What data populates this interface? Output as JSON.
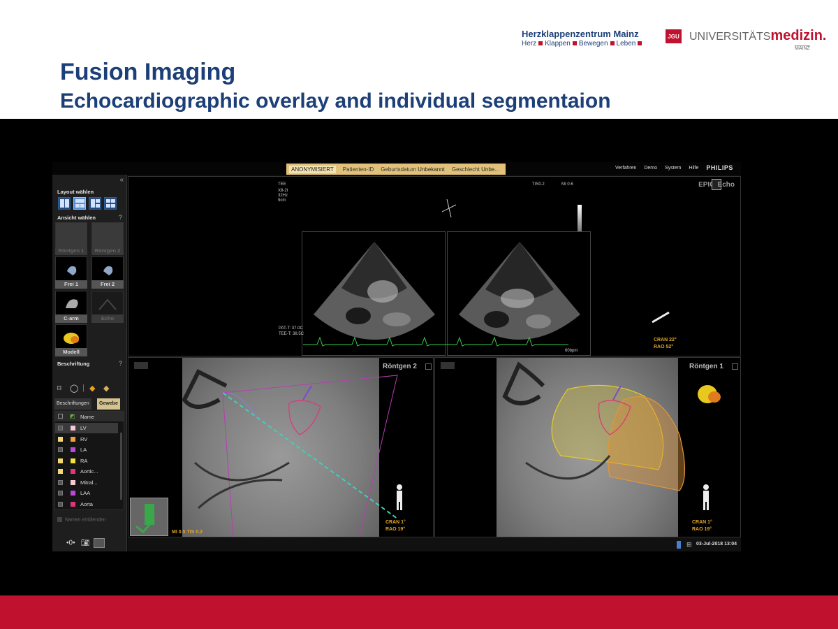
{
  "header": {
    "logo_hkz_title": "Herzklappenzentrum Mainz",
    "logo_hkz_tagline_words": [
      "Herz",
      "Klappen",
      "Bewegen",
      "Leben"
    ],
    "logo_jgu": "JGU",
    "logo_um_prefix": "UNIVERSITÄTS",
    "logo_um_bold": "medizin.",
    "logo_mainz": "MAINZ",
    "title": "Fusion Imaging",
    "subtitle": "Echocardiographic overlay and individual segmentaion"
  },
  "colors": {
    "brand_blue": "#1d3f78",
    "brand_red": "#c0112e",
    "orientation_text": "#e0a628",
    "selection_tab": "#d6c28c"
  },
  "app": {
    "patient_bar": {
      "anonymized": "ANONYMISIERT",
      "patient_id_label": "Patienten-ID",
      "birthdate_label": "Geburtsdatum",
      "birthdate_value": "Unbekannt",
      "sex_label": "Geschlecht",
      "sex_value": "Unbe..."
    },
    "menu": [
      "Verfahren",
      "Demo",
      "System",
      "Hilfe"
    ],
    "brand": "PHILIPS",
    "sidebar": {
      "collapse_icon": "«",
      "layout_header": "Layout wählen",
      "view_header": "Ansicht wählen",
      "help_icon": "?",
      "views": [
        {
          "label": "Röntgen 1",
          "enabled": false
        },
        {
          "label": "Röntgen 2",
          "enabled": false
        },
        {
          "label": "Frei 1",
          "enabled": true
        },
        {
          "label": "Frei 2",
          "enabled": true
        },
        {
          "label": "C-arm",
          "enabled": true
        },
        {
          "label": "Echo",
          "enabled": false
        },
        {
          "label": "Modell",
          "enabled": true
        }
      ],
      "annotation_header": "Beschriftung",
      "tab_annotations": "Beschriftungen",
      "tab_tissue": "Gewebe",
      "list_name_header": "Name",
      "tissues": [
        {
          "name": "LV",
          "checked": false,
          "color": "#f6c9d6"
        },
        {
          "name": "RV",
          "checked": true,
          "color": "#f2a23a"
        },
        {
          "name": "LA",
          "checked": false,
          "color": "#b84ad6"
        },
        {
          "name": "RA",
          "checked": true,
          "color": "#f2e23a"
        },
        {
          "name": "Aortic...",
          "checked": true,
          "color": "#e0357a"
        },
        {
          "name": "Mitral...",
          "checked": false,
          "color": "#f6c9d6"
        },
        {
          "name": "LAA",
          "checked": false,
          "color": "#b84ad6"
        },
        {
          "name": "Aorta",
          "checked": false,
          "color": "#e0357a"
        }
      ],
      "show_names": "Namen einblenden"
    },
    "echo_view": {
      "epiq": "EPIQ",
      "echo": "Echo",
      "probe": "TEE",
      "params": [
        "X8-2t",
        "32Hz",
        "9cm"
      ],
      "tis": "TIS0.2",
      "mi": "MI 0.6",
      "pat_t": "PAT-T: 37.0C",
      "tee_t": "TEE-T: 38.5C",
      "bpm": "60bpm",
      "cran": "CRAN  22°",
      "rao": "RAO  52°"
    },
    "r2_view": {
      "title": "Röntgen 2",
      "cran": "CRAN   1°",
      "rao": "RAO  19°",
      "mi_tis": "MI 0.5  TIS 0.2"
    },
    "r1_view": {
      "title": "Röntgen 1",
      "cran": "CRAN   1°",
      "rao": "RAO  19°"
    },
    "status": {
      "datetime": "03-Jul-2018 13:04"
    }
  }
}
